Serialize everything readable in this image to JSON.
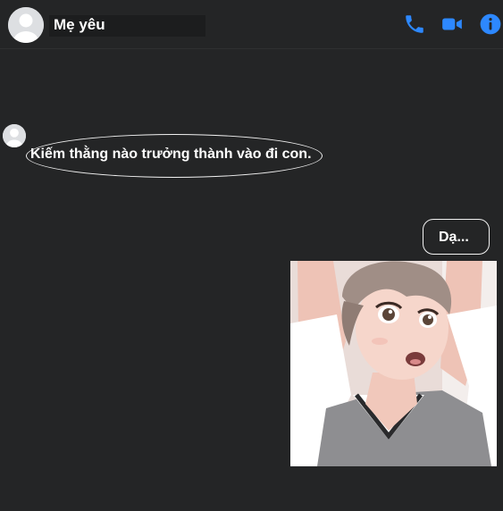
{
  "header": {
    "contact_name": "Mẹ yêu",
    "avatar_icon": "default-avatar-icon",
    "actions": [
      {
        "name": "phone-call",
        "icon": "phone-icon"
      },
      {
        "name": "video-call",
        "icon": "video-icon"
      },
      {
        "name": "conversation-info",
        "icon": "info-icon"
      }
    ]
  },
  "messages": [
    {
      "direction": "incoming",
      "text": "Kiếm thằng nào trưởng thành vào đi con."
    },
    {
      "direction": "outgoing",
      "text": "Dạ..."
    },
    {
      "direction": "outgoing",
      "type": "image",
      "image": "anime-boy-photo"
    }
  ],
  "colors": {
    "background": "#242526",
    "accent_blue": "#2d88ff",
    "text": "#ffffff",
    "bubble_border": "#f2f2f2"
  }
}
